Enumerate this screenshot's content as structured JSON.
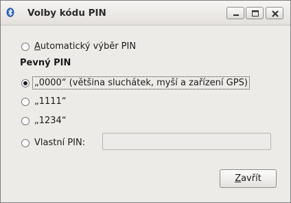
{
  "window": {
    "title": "Volby kódu PIN",
    "icon": "bluetooth-icon",
    "controls": [
      "minimize-icon",
      "maximize-icon",
      "close-icon"
    ]
  },
  "options": {
    "auto": {
      "accel": "A",
      "rest": "utomatický výběr PIN",
      "checked": false
    },
    "fixed_heading": "Pevný PIN",
    "fixed": [
      {
        "label": "„0000“ (většina sluchátek, myší a zařízení GPS)",
        "checked": true
      },
      {
        "label": "„1111“",
        "checked": false
      },
      {
        "label": "„1234“",
        "checked": false
      }
    ],
    "custom": {
      "label": "Vlastní PIN:",
      "value": "",
      "checked": false
    }
  },
  "buttons": {
    "close": {
      "accel": "Z",
      "rest": "avřít"
    }
  }
}
